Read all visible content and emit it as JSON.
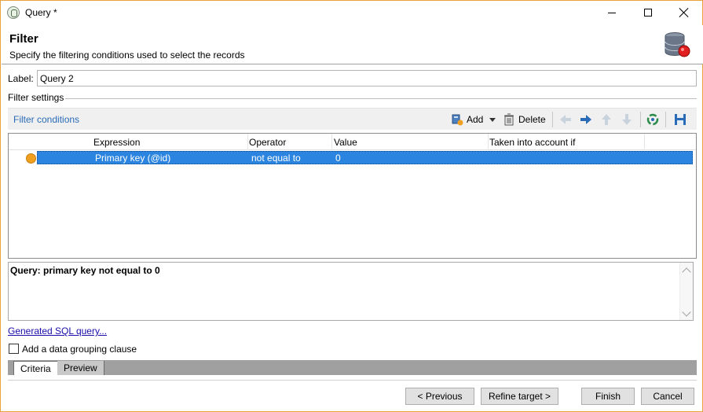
{
  "window": {
    "title": "Query *"
  },
  "header": {
    "title": "Filter",
    "subtitle": "Specify the filtering conditions used to select the records"
  },
  "label_field": {
    "label": "Label:",
    "value": "Query 2"
  },
  "filter_settings": {
    "title": "Filter settings",
    "toolbar": {
      "title": "Filter conditions",
      "add_label": "Add",
      "delete_label": "Delete"
    },
    "columns": [
      "Expression",
      "Operator",
      "Value",
      "Taken into account if"
    ],
    "rows": [
      {
        "expression": "Primary key (@id)",
        "operator": "not equal to",
        "value": "0",
        "condition": ""
      }
    ]
  },
  "summary": {
    "text": "Query: primary key not equal to 0"
  },
  "sql_link": "Generated SQL query...",
  "grouping": {
    "label": "Add a data grouping clause",
    "checked": false
  },
  "tabs": [
    "Criteria",
    "Preview"
  ],
  "buttons": {
    "previous": "< Previous",
    "refine": "Refine target >",
    "finish": "Finish",
    "cancel": "Cancel"
  },
  "colors": {
    "accent": "#2b84e0",
    "link": "#2a6bb8",
    "row_marker": "#f0a020",
    "window_border": "#e8a33d"
  },
  "icons": [
    "app-icon",
    "minimize-icon",
    "maximize-icon",
    "close-icon",
    "database-icon",
    "add-condition-icon",
    "delete-icon",
    "arrow-left-icon",
    "arrow-right-icon",
    "arrow-up-icon",
    "arrow-down-icon",
    "refresh-icon",
    "save-icon"
  ]
}
